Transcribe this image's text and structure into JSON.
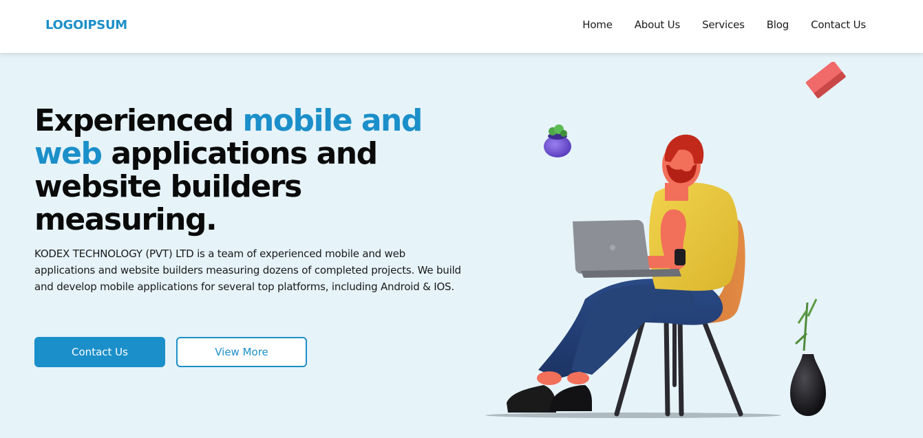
{
  "brand": {
    "logo_text": "LOGOIPSUM",
    "primary_color": "#1b8fc9"
  },
  "nav": {
    "items": [
      {
        "label": "Home"
      },
      {
        "label": "About Us"
      },
      {
        "label": "Services"
      },
      {
        "label": "Blog"
      },
      {
        "label": "Contact Us"
      }
    ]
  },
  "hero": {
    "title_part1": "Experienced ",
    "title_accent": "mobile and web",
    "title_part2": " applications and website builders measuring.",
    "description": "KODEX TECHNOLOGY (PVT) LTD is a team of experienced mobile and web applications and website builders measuring dozens of completed projects. We build and develop mobile applications for several top platforms, including Android & IOS.",
    "primary_button": "Contact Us",
    "secondary_button": "View More"
  },
  "illustration": {
    "subject": "person-with-laptop-on-chair",
    "decorations": [
      "potted-plant-icon",
      "eraser-block-icon",
      "vase-plant-icon"
    ]
  },
  "colors": {
    "page_bg": "#e6f3f9",
    "accent": "#1b8fc9",
    "text": "#0a0a0a"
  }
}
